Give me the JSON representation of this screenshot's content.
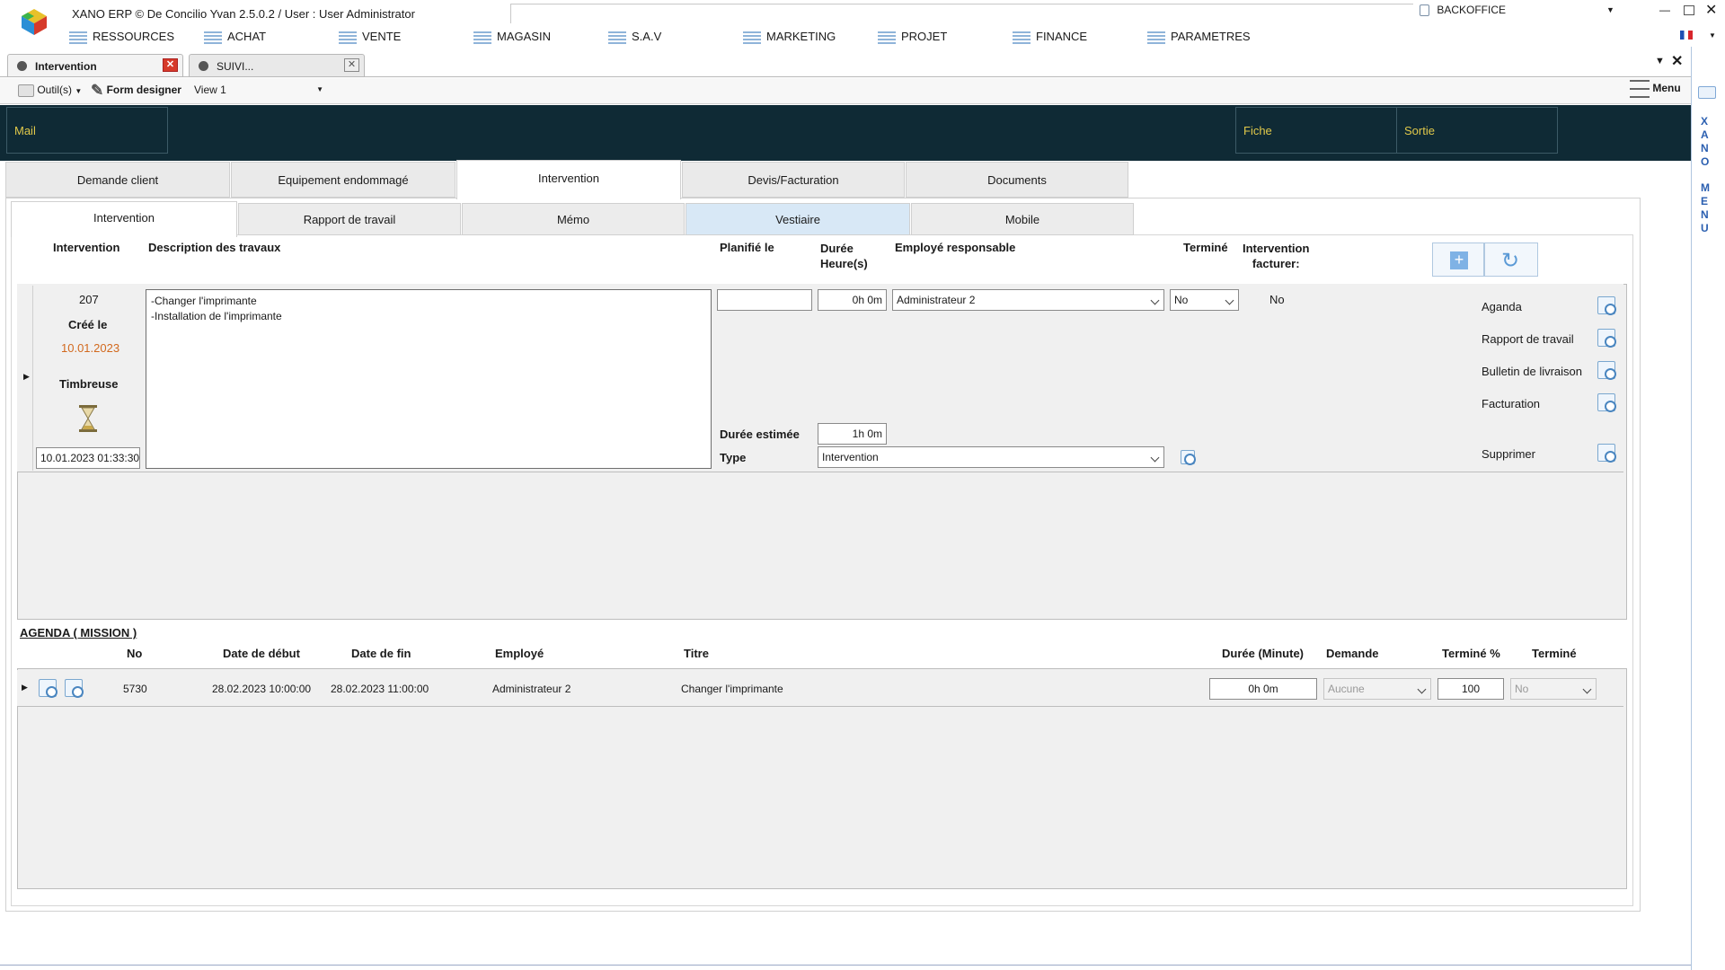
{
  "titlebar": {
    "app_title": "XANO ERP © De Concilio Yvan 2.5.0.2 / User : User Administrator",
    "backoffice": "BACKOFFICE",
    "flag": "🇫🇷"
  },
  "menu": [
    "RESSOURCES",
    "ACHAT",
    "VENTE",
    "MAGASIN",
    "S.A.V",
    "MARKETING",
    "PROJET",
    "FINANCE",
    "PARAMETRES"
  ],
  "doc_tabs": [
    {
      "label": "Intervention"
    },
    {
      "label": "SUIVI..."
    }
  ],
  "toolbar": {
    "tools_label": "Outil(s)",
    "form_designer_label": "Form designer",
    "view_select": "View 1",
    "menu_label": "Menu"
  },
  "dark_bar": {
    "mail": "Mail",
    "fiche": "Fiche",
    "sortie": "Sortie"
  },
  "main_tabs": [
    "Demande client",
    "Equipement endommagé",
    "Intervention",
    "Devis/Facturation",
    "Documents"
  ],
  "sub_tabs": [
    "Intervention",
    "Rapport de travail",
    "Mémo",
    "Vestiaire",
    "Mobile"
  ],
  "headers": {
    "intervention": "Intervention",
    "description": "Description des travaux",
    "planned": "Planifié le",
    "duration_l1": "Durée",
    "duration_l2": "Heure(s)",
    "employee": "Employé responsable",
    "done": "Terminé",
    "billing_l1": "Intervention",
    "billing_l2": "facturer:"
  },
  "record": {
    "number": "207",
    "created_label": "Créé le",
    "created_date": "10.01.2023",
    "stamp_label": "Timbreuse",
    "stamp_value": "10.01.2023 01:33:30",
    "description": "-Changer l'imprimante\n-Installation de l'imprimante",
    "planned_value": "",
    "duration_value": "0h 0m",
    "employee_value": "Administrateur 2",
    "done_value": "No",
    "billing_value": "No",
    "estimated_label": "Durée estimée",
    "estimated_value": "1h 0m",
    "type_label": "Type",
    "type_value": "Intervention"
  },
  "actions": [
    "Aganda",
    "Rapport de travail",
    "Bulletin de livraison",
    "Facturation",
    "Supprimer"
  ],
  "agenda": {
    "title": "AGENDA ( MISSION )",
    "columns": [
      "No",
      "Date de début",
      "Date de fin",
      "Employé",
      "Titre",
      "Durée (Minute)",
      "Demande",
      "Terminé %",
      "Terminé"
    ],
    "rows": [
      {
        "no": "5730",
        "start": "28.02.2023 10:00:00",
        "end": "28.02.2023 11:00:00",
        "employee": "Administrateur 2",
        "title": "Changer l'imprimante",
        "duration": "0h 0m",
        "demande": "Aucune",
        "percent": "100",
        "done": "No"
      }
    ]
  },
  "side_vertical": {
    "xano": [
      "X",
      "A",
      "N",
      "O"
    ],
    "menu": [
      "M",
      "E",
      "N",
      "U"
    ]
  },
  "colors": {
    "dark_bar": "#0f2a35",
    "dark_text": "#e0c84a",
    "created_date": "#d2691e",
    "side_text": "#2b5fb0"
  }
}
